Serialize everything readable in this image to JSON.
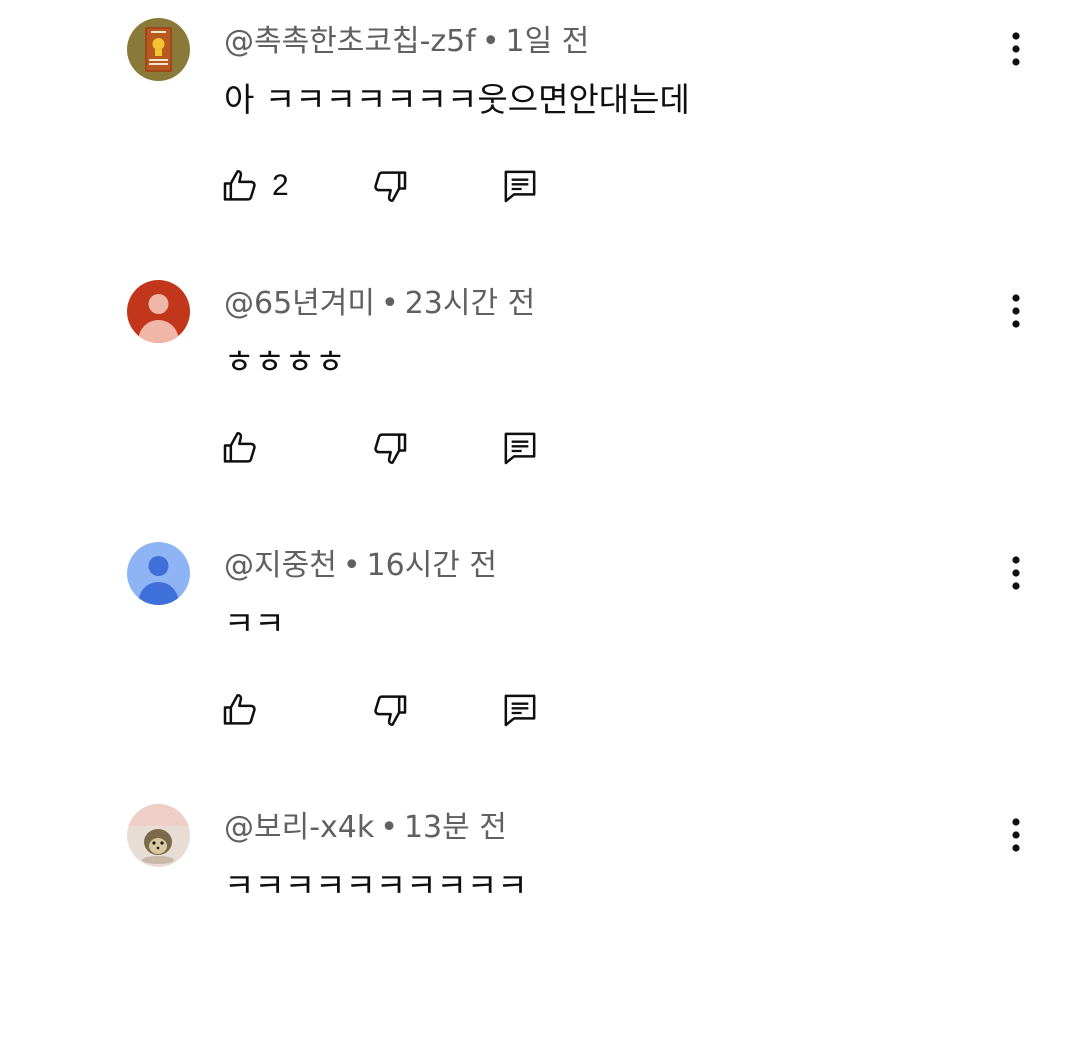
{
  "comments": [
    {
      "author": "@촉촉한초코칩-z5f",
      "time": "1일 전",
      "separator": "•",
      "text": "아 ㅋㅋㅋㅋㅋㅋㅋ웃으면안대는데",
      "likes": "2",
      "avatar_icon": "book-cover-avatar",
      "avatar_color": "#8a7a3a"
    },
    {
      "author": "@65년겨미",
      "time": "23시간 전",
      "separator": "•",
      "text": "ㅎㅎㅎㅎ",
      "likes": "",
      "avatar_icon": "default-person-avatar",
      "avatar_color": "#c2361c"
    },
    {
      "author": "@지중천",
      "time": "16시간 전",
      "separator": "•",
      "text": "ㅋㅋ",
      "likes": "",
      "avatar_icon": "default-person-avatar",
      "avatar_color": "#8fb4f5"
    },
    {
      "author": "@보리-x4k",
      "time": "13분 전",
      "separator": "•",
      "text": "ㅋㅋㅋㅋㅋㅋㅋㅋㅋㅋ",
      "likes": "",
      "avatar_icon": "hedgehog-photo-avatar",
      "avatar_color": "#e8ddd5"
    }
  ]
}
